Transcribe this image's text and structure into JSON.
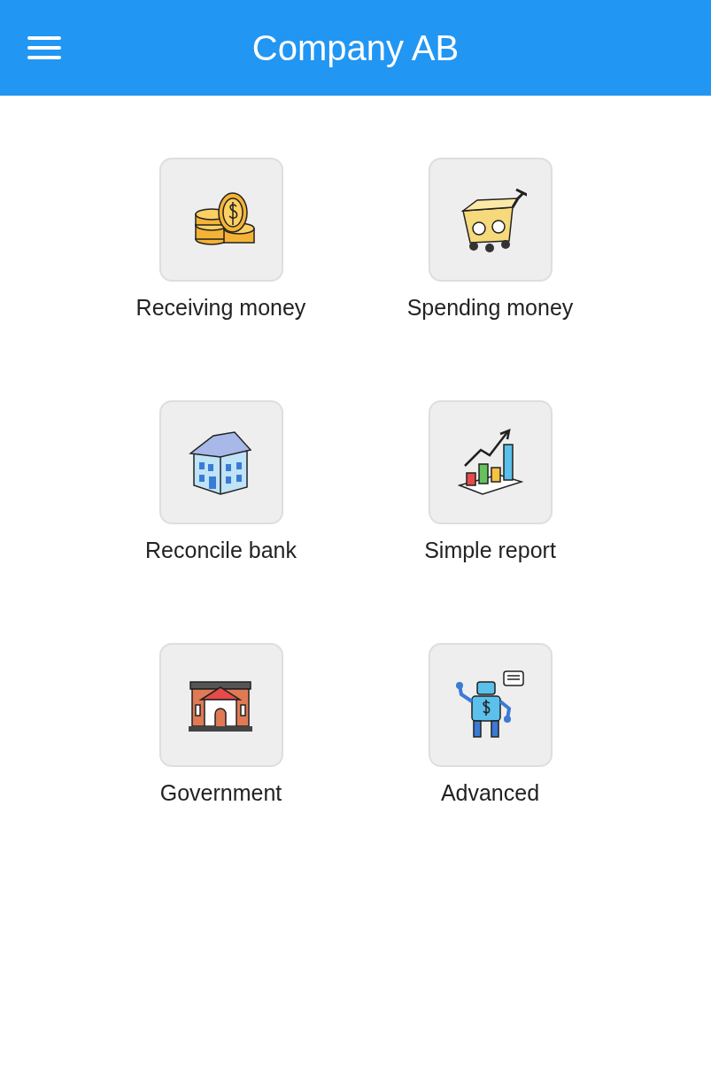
{
  "header": {
    "title": "Company AB"
  },
  "tiles": [
    {
      "label": "Receiving money",
      "kind": "coins"
    },
    {
      "label": "Spending money",
      "kind": "cart"
    },
    {
      "label": "Reconcile bank",
      "kind": "bank"
    },
    {
      "label": "Simple report",
      "kind": "chart"
    },
    {
      "label": "Government",
      "kind": "government"
    },
    {
      "label": "Advanced",
      "kind": "robot"
    }
  ]
}
